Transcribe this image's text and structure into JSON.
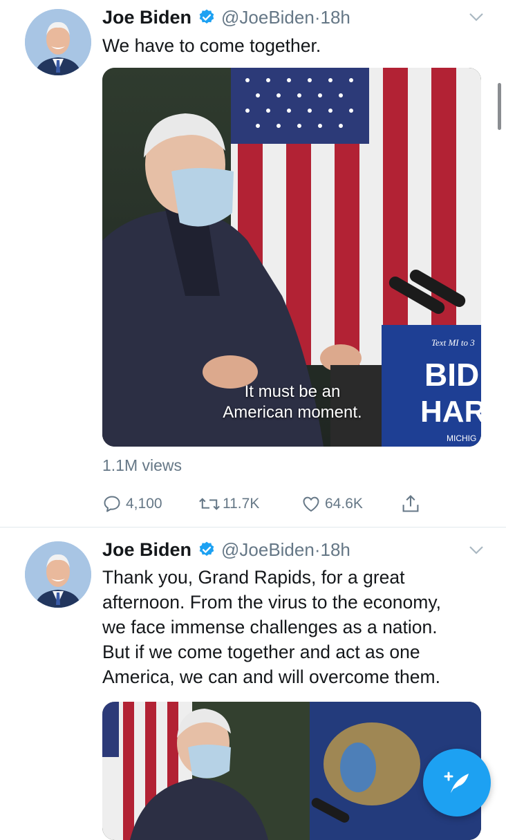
{
  "tweets": [
    {
      "author": "Joe Biden",
      "handle": "@JoeBiden",
      "separator": "·",
      "time": "18h",
      "text": "We have to come together.",
      "media_caption_line1": "It must be an",
      "media_caption_line2": "American moment.",
      "sign_small": "Text MI to 3",
      "sign_big1": "BID",
      "sign_big2": "HAR",
      "sign_bottom": "MICHIG",
      "views": "1.1M views",
      "replies": "4,100",
      "retweets": "11.7K",
      "likes": "64.6K"
    },
    {
      "author": "Joe Biden",
      "handle": "@JoeBiden",
      "separator": "·",
      "time": "18h",
      "text_lines": [
        "Thank you, Grand Rapids, for a great",
        "afternoon. From the virus to the economy,",
        "we face immense challenges as a nation.",
        "But if we come together and act as one",
        "America, we can and will overcome them."
      ]
    }
  ],
  "colors": {
    "accent": "#1da1f2",
    "secondary_text": "#657786"
  },
  "icons": [
    "verified-badge-icon",
    "chevron-down-icon",
    "reply-icon",
    "retweet-icon",
    "like-icon",
    "share-icon",
    "compose-tweet-icon"
  ]
}
